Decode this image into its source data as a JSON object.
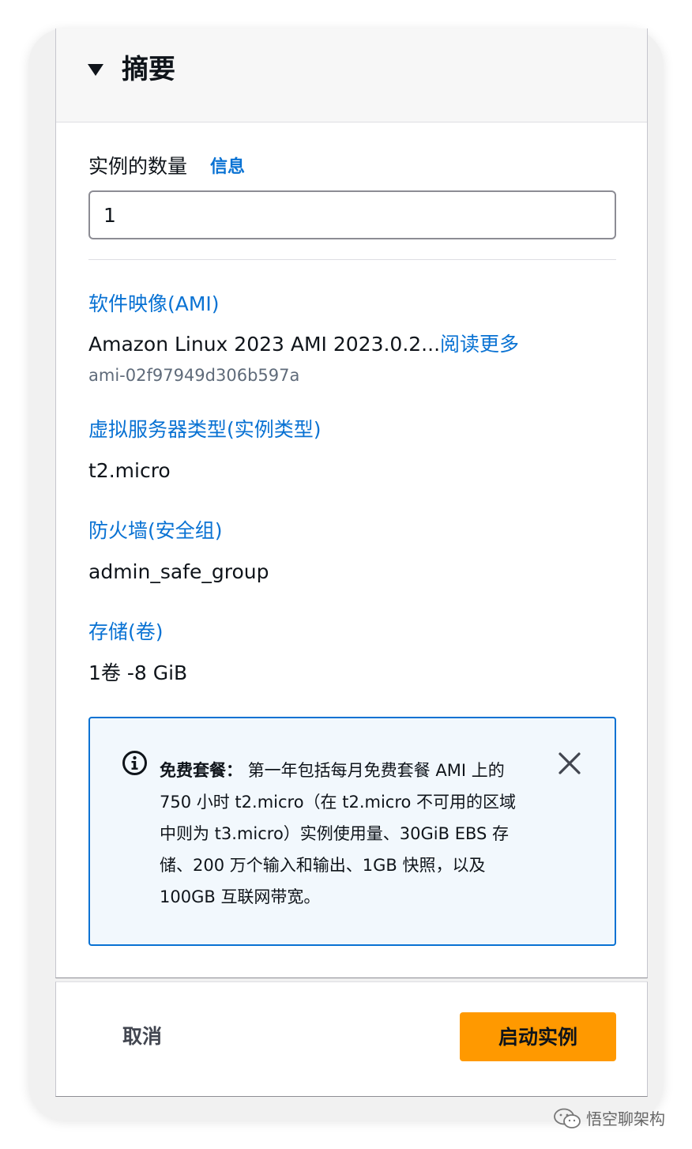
{
  "summary": {
    "title": "摘要",
    "instance_count": {
      "label": "实例的数量",
      "info_link": "信息",
      "value": "1"
    },
    "ami": {
      "label": "软件映像(AMI)",
      "name": "Amazon Linux 2023 AMI 2023.0.2...",
      "read_more": "阅读更多",
      "id": "ami-02f97949d306b597a"
    },
    "instance_type": {
      "label": "虚拟服务器类型(实例类型)",
      "value": "t2.micro"
    },
    "firewall": {
      "label": "防火墙(安全组)",
      "value": "admin_safe_group"
    },
    "storage": {
      "label": "存储(卷)",
      "value": "1卷 -8 GiB"
    },
    "free_tier_alert": {
      "title": "免费套餐：",
      "message": " 第一年包括每月免费套餐 AMI 上的 750 小时 t2.micro（在 t2.micro 不可用的区域中则为 t3.micro）实例使用量、30GiB EBS 存储、200 万个输入和输出、1GB 快照，以及 100GB 互联网带宽。",
      "icon": "info-icon",
      "close_icon": "close-icon"
    }
  },
  "footer": {
    "cancel_label": "取消",
    "launch_label": "启动实例"
  },
  "watermark": {
    "text": "悟空聊架构",
    "icon": "wechat-icon"
  },
  "colors": {
    "link": "#0972d3",
    "primary_button": "#ff9900",
    "alert_background": "#f2f8fd",
    "text": "#0f141a"
  }
}
